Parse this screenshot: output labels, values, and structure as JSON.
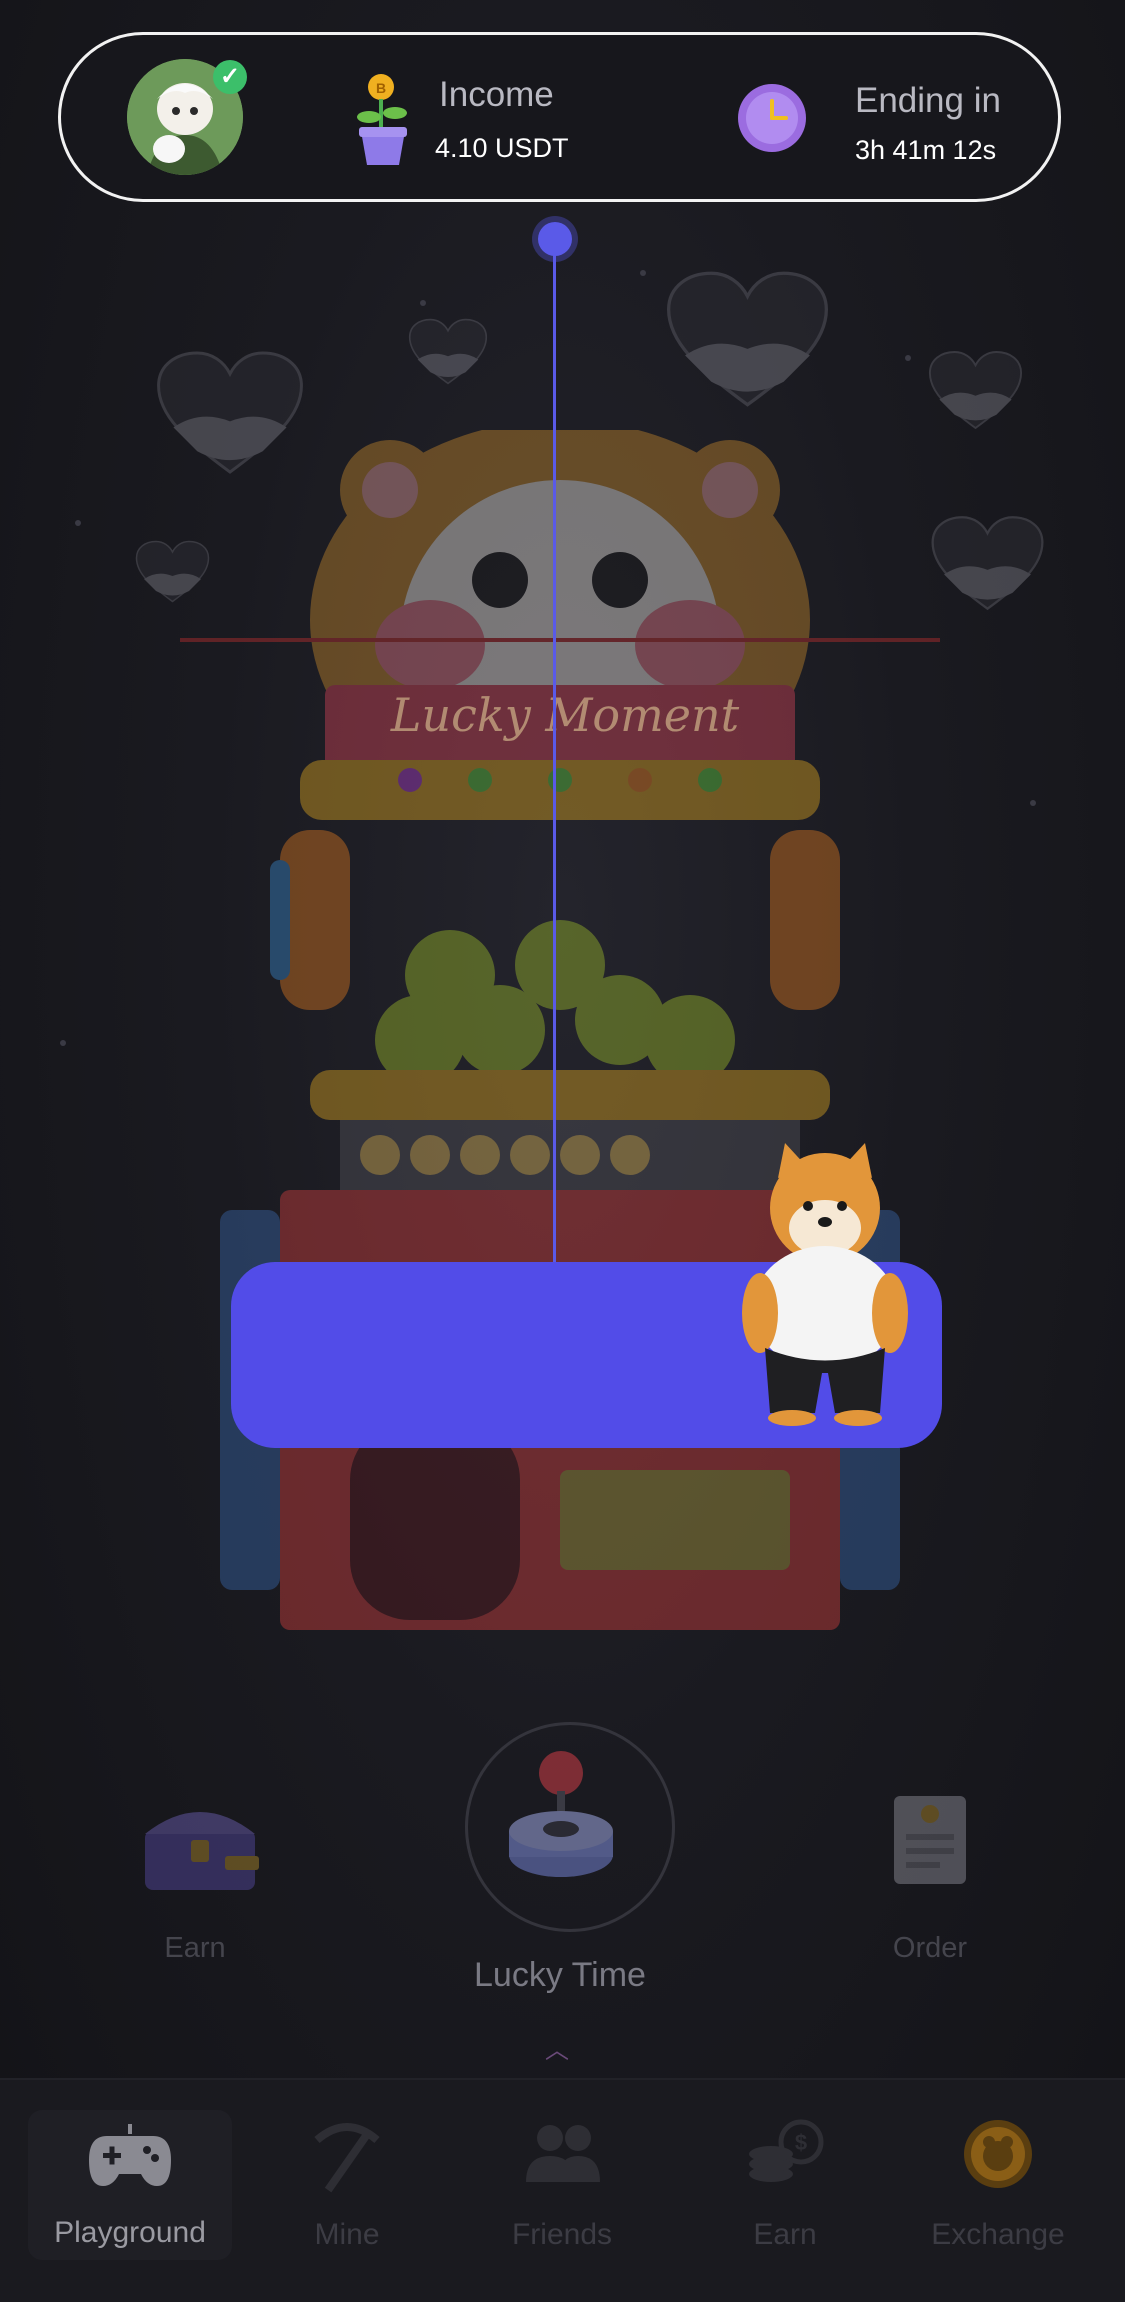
{
  "header": {
    "avatar_icon": "user-avatar",
    "income": {
      "label": "Income",
      "value": "4.10 USDT",
      "icon": "money-plant-icon"
    },
    "timer": {
      "label": "Ending in",
      "value": "3h 41m 12s",
      "icon": "clock-icon"
    }
  },
  "machine": {
    "title": "Lucky Moment"
  },
  "actions": {
    "earn": {
      "label": "Earn",
      "icon": "treasure-chest-icon"
    },
    "play": {
      "label": "Lucky Time",
      "icon": "joystick-icon"
    },
    "order": {
      "label": "Order",
      "icon": "receipt-icon"
    }
  },
  "nav": {
    "items": [
      {
        "label": "Playground",
        "icon": "gamepad-icon",
        "active": true
      },
      {
        "label": "Mine",
        "icon": "pickaxe-icon",
        "active": false
      },
      {
        "label": "Friends",
        "icon": "friends-icon",
        "active": false
      },
      {
        "label": "Earn",
        "icon": "coins-icon",
        "active": false
      },
      {
        "label": "Exchange",
        "icon": "exchange-coin-icon",
        "active": false
      }
    ]
  },
  "colors": {
    "accent": "#524ce8",
    "background": "#151519",
    "text_primary": "#ffffff",
    "text_muted": "#b9b9c2"
  }
}
